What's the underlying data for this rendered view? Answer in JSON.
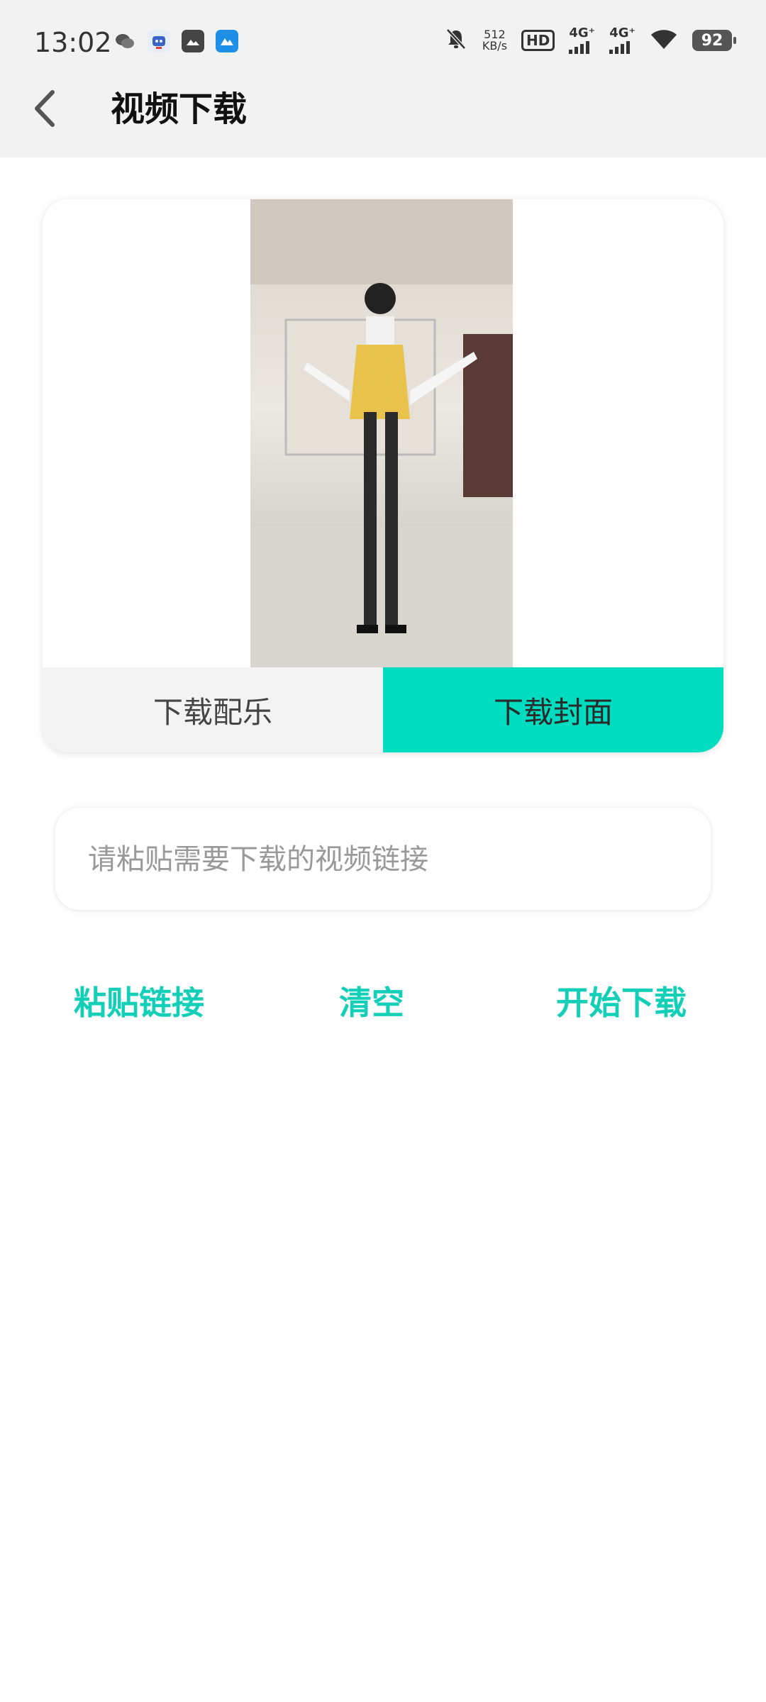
{
  "status_bar": {
    "time": "13:02",
    "net_speed_value": "512",
    "net_speed_unit": "KB/s",
    "hd_label": "HD",
    "sim1_label": "4G⁺",
    "sim2_label": "4G⁺",
    "battery": "92",
    "notification_icons": [
      "wechat-icon",
      "robot-app-icon",
      "gallery-app-icon",
      "mountain-app-icon"
    ]
  },
  "header": {
    "title": "视频下载",
    "back_icon": "chevron-left-icon"
  },
  "preview_card": {
    "tab_music": "下载配乐",
    "tab_cover": "下载封面"
  },
  "url_input": {
    "placeholder": "请粘贴需要下载的视频链接",
    "value": ""
  },
  "actions": {
    "paste": "粘贴链接",
    "clear": "清空",
    "start": "开始下载"
  },
  "colors": {
    "accent": "#00dcc0",
    "action_text": "#14cfb8",
    "header_bg": "#f2f2f2"
  }
}
